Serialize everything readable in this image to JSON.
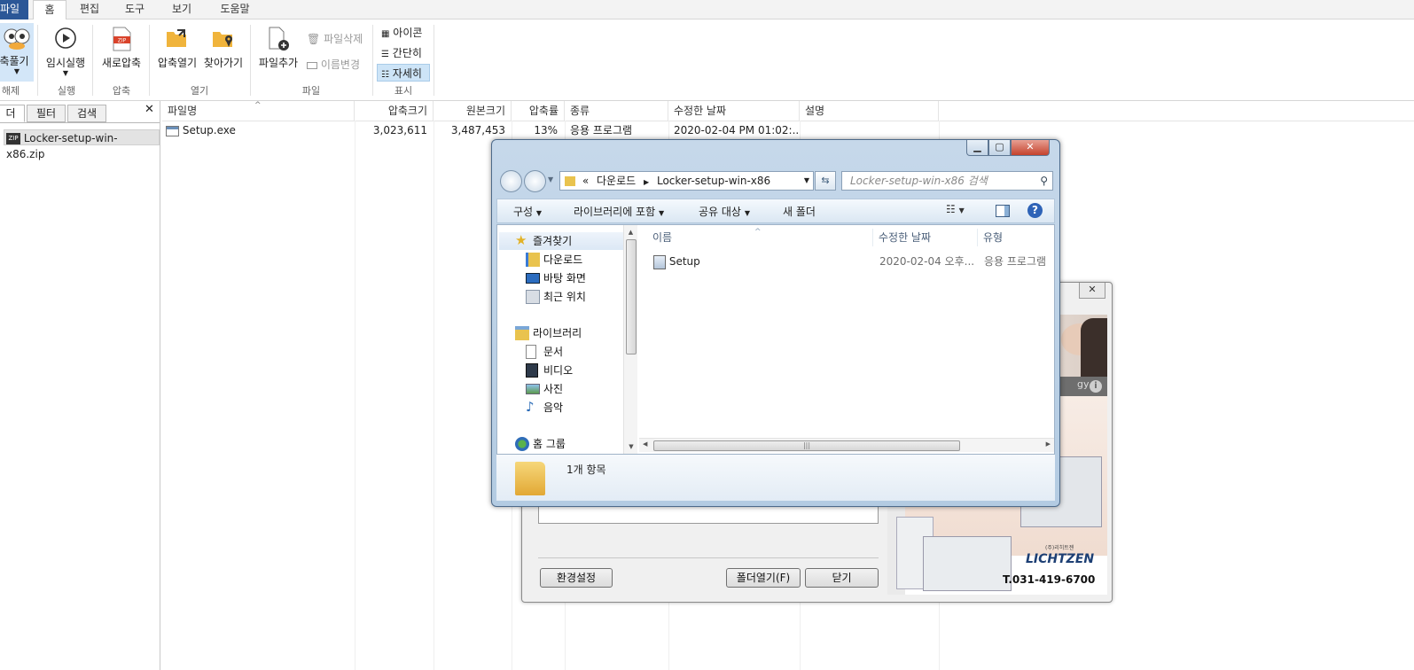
{
  "menubar": {
    "file": "파일",
    "tabs": [
      "홈",
      "편집",
      "도구",
      "보기",
      "도움말"
    ]
  },
  "ribbon": {
    "extract_label": "축풀기",
    "run_label": "임시실행",
    "new_zip_label": "새로압축",
    "open_archive_label": "압축열기",
    "browse_label": "찾아가기",
    "add_file_label": "파일추가",
    "delete_label": "파일삭제",
    "rename_label": "이름변경",
    "view_icons": "아이콘",
    "view_simple": "간단히",
    "view_details": "자세히",
    "groups": {
      "extract": "해제",
      "run": "실행",
      "compress": "압축",
      "open": "열기",
      "file": "파일",
      "view": "표시"
    }
  },
  "left_panel": {
    "tabs": [
      "더",
      "필터",
      "검색"
    ],
    "close": "✕",
    "tree_item": "Locker-setup-win-x86.zip"
  },
  "file_list": {
    "columns": [
      "파일명",
      "압축크기",
      "원본크기",
      "압축률",
      "종류",
      "수정한 날짜",
      "설명"
    ],
    "rows": [
      {
        "name": "Setup.exe",
        "compressed": "3,023,611",
        "original": "3,487,453",
        "ratio": "13%",
        "type": "응용 프로그램",
        "modified": "2020-02-04 PM 01:02:..."
      }
    ]
  },
  "back_dialog": {
    "close": "✕",
    "settings_button": "환경설정",
    "open_folder_button": "폴더열기(F)",
    "close_button": "닫기",
    "ad": {
      "text_partial": "gy",
      "brand": "LICHTZEN",
      "brand_small": "(주)리히트젠",
      "phone": "T.031-419-6700"
    }
  },
  "explorer": {
    "address_prefix": "«",
    "address_parts": [
      "다운로드",
      "Locker-setup-win-x86"
    ],
    "search_placeholder": "Locker-setup-win-x86 검색",
    "toolbar": {
      "organize": "구성",
      "include_library": "라이브러리에 포함",
      "share": "공유 대상",
      "new_folder": "새 폴더"
    },
    "nav": {
      "favorites": "즐겨찾기",
      "downloads": "다운로드",
      "desktop": "바탕 화면",
      "recent": "최근 위치",
      "libraries": "라이브러리",
      "documents": "문서",
      "videos": "비디오",
      "pictures": "사진",
      "music": "음악",
      "homegroup": "홈 그룹"
    },
    "columns": {
      "name": "이름",
      "modified": "수정한 날짜",
      "type": "유형"
    },
    "item": {
      "name": "Setup",
      "modified": "2020-02-04 오후...",
      "type": "응용 프로그램"
    },
    "status": "1개 항목"
  }
}
